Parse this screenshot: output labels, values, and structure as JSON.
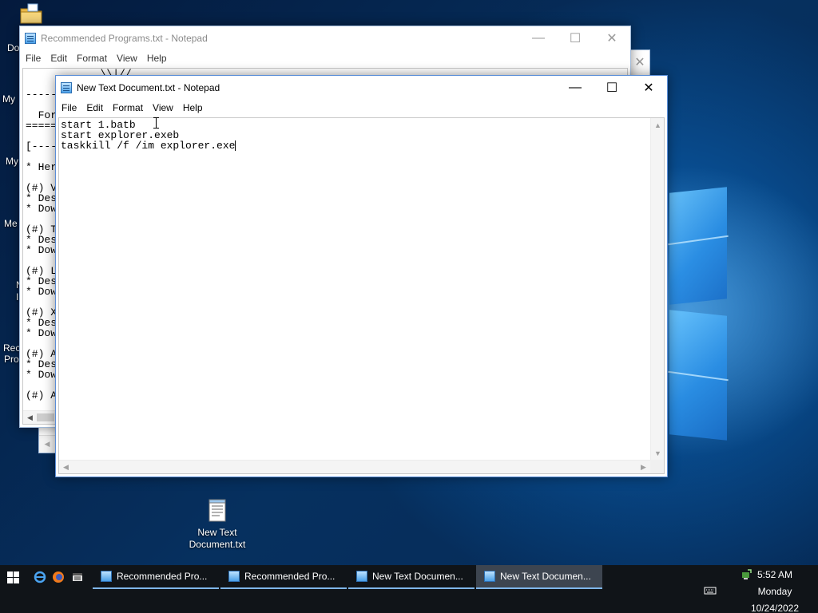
{
  "desktop": {
    "file_icon_label_line1": "New Text",
    "file_icon_label_line2": "Document.txt",
    "left_labels": [
      "Do",
      "My",
      "My",
      "Me",
      "N",
      "I",
      "Rec",
      "Pro"
    ]
  },
  "back_window": {
    "title": "Recommended Programs.txt - Notepad",
    "menu": [
      "File",
      "Edit",
      "Format",
      "View",
      "Help"
    ],
    "visible_lines": [
      "            \\\\|//",
      "",
      "-----",
      "",
      "  For",
      "=====",
      "",
      "[----",
      "",
      "* Her",
      "",
      "(#) V",
      "* Des",
      "* Dow",
      "",
      "(#) T",
      "* Des",
      "* Dow",
      "",
      "(#) L",
      "* Des",
      "* Dow",
      "",
      "(#) X",
      "* Des",
      "* Dow",
      "",
      "(#) A",
      "* Des",
      "* Dow",
      "",
      "(#) A"
    ]
  },
  "front_window": {
    "title": "New Text Document.txt - Notepad",
    "menu": [
      "File",
      "Edit",
      "Format",
      "View",
      "Help"
    ],
    "lines": [
      "start 1.batb",
      "start explorer.exeb",
      "taskkill /f /im explorer.exe"
    ]
  },
  "caption": {
    "minimize": "—",
    "maximize": "☐",
    "close": "✕"
  },
  "taskbar": {
    "buttons": [
      {
        "label": "Recommended Pro...",
        "active": false
      },
      {
        "label": "Recommended Pro...",
        "active": false
      },
      {
        "label": "New Text Documen...",
        "active": false
      },
      {
        "label": "New Text Documen...",
        "active": true
      }
    ],
    "time": "5:52 AM",
    "day": "Monday",
    "date": "10/24/2022"
  },
  "colors": {
    "taskbar": "#101418",
    "accent": "#7fb6ea",
    "window_border": "#5a8ed8"
  },
  "icons": [
    "folder-icon",
    "notepad-file-icon",
    "windows-logo-icon",
    "ie-icon",
    "firefox-icon",
    "media-icon",
    "keyboard-icon",
    "network-icon"
  ]
}
